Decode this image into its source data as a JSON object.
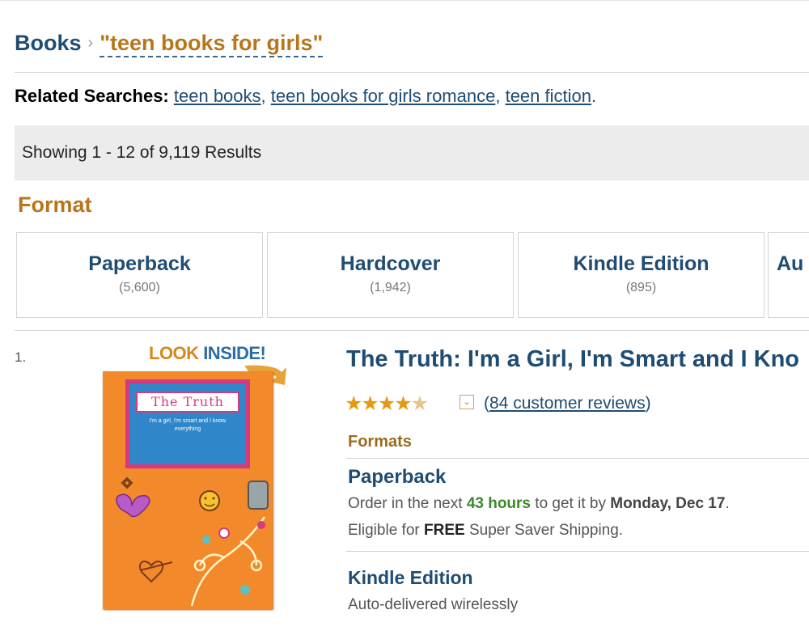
{
  "breadcrumb": {
    "category": "Books",
    "separator": "›",
    "query": "\"teen books for girls\""
  },
  "related": {
    "label": "Related Searches:",
    "links": [
      "teen books",
      "teen books for girls romance",
      "teen fiction"
    ],
    "end": "."
  },
  "results_text": "Showing 1 - 12 of 9,119 Results",
  "format_section": {
    "title": "Format",
    "tiles": [
      {
        "name": "Paperback",
        "count": "(5,600)"
      },
      {
        "name": "Hardcover",
        "count": "(1,942)"
      },
      {
        "name": "Kindle Edition",
        "count": "(895)"
      },
      {
        "name": "Au",
        "count": ""
      }
    ]
  },
  "result": {
    "number": "1.",
    "look_inside": {
      "part1": "LOOK",
      "part2": "INSIDE!"
    },
    "cover": {
      "title": "The Truth",
      "text": "I'm a girl, I'm smart and I know everything"
    },
    "title": "The Truth: I'm a Girl, I'm Smart and I Kno",
    "rating": {
      "value": 4.5,
      "out_of": 5,
      "review_link": "84 customer reviews"
    },
    "formats_label": "Formats",
    "paperback": {
      "label": "Paperback",
      "order_prefix": "Order in the next",
      "hours": "43 hours",
      "order_mid": "to get it by",
      "date": "Monday, Dec 17",
      "order_end": ".",
      "eligible_prefix": "Eligible for",
      "free": "FREE",
      "eligible_suffix": "Super Saver Shipping."
    },
    "kindle": {
      "label": "Kindle Edition",
      "delivery": "Auto-delivered wirelessly"
    }
  },
  "colors": {
    "link_blue": "#1f4c73",
    "accent_orange": "#b8761b",
    "green": "#3a8a2b",
    "star": "#e69a13"
  }
}
